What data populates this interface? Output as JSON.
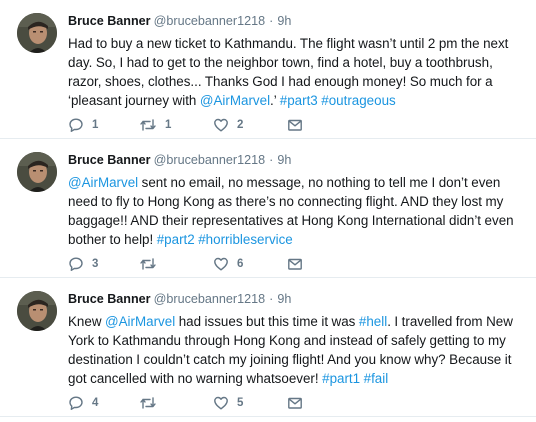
{
  "tweets": [
    {
      "display_name": "Bruce Banner",
      "handle": "@brucebanner1218",
      "separator": "·",
      "time": "9h",
      "text_segments": [
        {
          "text": "Had to buy a new ticket to Kathmandu. The flight wasn’t until 2 pm the next day. So, I had to get to the neighbor town, find a hotel, buy a toothbrush, razor, shoes, clothes... Thanks God I had enough money! So much for a ‘pleasant journey with ",
          "link": false
        },
        {
          "text": "@AirMarvel",
          "link": true
        },
        {
          "text": ".’ ",
          "link": false
        },
        {
          "text": "#part3",
          "link": true
        },
        {
          "text": " ",
          "link": false
        },
        {
          "text": "#outrageous",
          "link": true
        }
      ],
      "reply_count": "1",
      "retweet_count": "1",
      "like_count": "2",
      "icons": {
        "reply": "reply-icon",
        "retweet": "retweet-icon",
        "like": "heart-icon",
        "dm": "envelope-icon"
      }
    },
    {
      "display_name": "Bruce Banner",
      "handle": "@brucebanner1218",
      "separator": "·",
      "time": "9h",
      "text_segments": [
        {
          "text": "@AirMarvel",
          "link": true
        },
        {
          "text": " sent no email, no message, no nothing to tell me I don’t even need to fly to Hong Kong as there’s no connecting flight. AND they lost my baggage!! AND their representatives at Hong Kong International didn’t even bother to help! ",
          "link": false
        },
        {
          "text": "#part2",
          "link": true
        },
        {
          "text": " ",
          "link": false
        },
        {
          "text": "#horribleservice",
          "link": true
        }
      ],
      "reply_count": "3",
      "retweet_count": "",
      "like_count": "6",
      "icons": {
        "reply": "reply-icon",
        "retweet": "retweet-icon",
        "like": "heart-icon",
        "dm": "envelope-icon"
      }
    },
    {
      "display_name": "Bruce Banner",
      "handle": "@brucebanner1218",
      "separator": "·",
      "time": "9h",
      "text_segments": [
        {
          "text": "Knew ",
          "link": false
        },
        {
          "text": "@AirMarvel",
          "link": true
        },
        {
          "text": " had issues but this time it was ",
          "link": false
        },
        {
          "text": "#hell",
          "link": true
        },
        {
          "text": ". I travelled from New York to Kathmandu through Hong Kong and instead of safely getting to my destination I couldn’t catch my joining flight! And you know why? Because it got cancelled with no warning whatsoever! ",
          "link": false
        },
        {
          "text": "#part1",
          "link": true
        },
        {
          "text": " ",
          "link": false
        },
        {
          "text": "#fail",
          "link": true
        }
      ],
      "reply_count": "4",
      "retweet_count": "",
      "like_count": "5",
      "icons": {
        "reply": "reply-icon",
        "retweet": "retweet-icon",
        "like": "heart-icon",
        "dm": "envelope-icon"
      }
    }
  ],
  "colors": {
    "link": "#1b95e0",
    "secondary_text": "#657786",
    "primary_text": "#14171a",
    "divider": "#e6ecf0"
  }
}
